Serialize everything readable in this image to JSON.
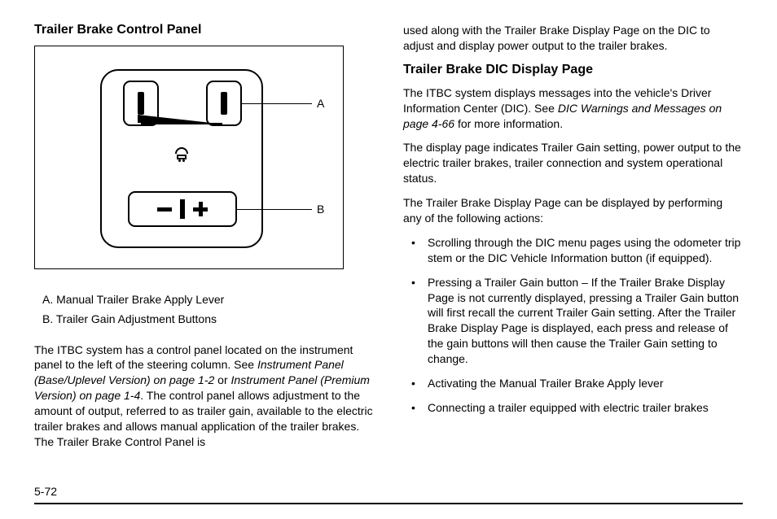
{
  "left": {
    "heading": "Trailer Brake Control Panel",
    "diagram": {
      "labelA": "A",
      "labelB": "B"
    },
    "legendA": "A.  Manual Trailer Brake Apply Lever",
    "legendB": "B.  Trailer Gain Adjustment Buttons",
    "para1_a": "The ITBC system has a control panel located on the instrument panel to the left of the steering column. See ",
    "para1_ital1": "Instrument Panel (Base/Uplevel Version) on page 1-2",
    "para1_b": " or ",
    "para1_ital2": "Instrument Panel (Premium Version) on page 1-4",
    "para1_c": ". The control panel allows adjustment to the amount of output, referred to as trailer gain, available to the electric trailer brakes and allows manual application of the trailer brakes. The Trailer Brake Control Panel is"
  },
  "right": {
    "cont": "used along with the Trailer Brake Display Page on the DIC to adjust and display power output to the trailer brakes.",
    "heading": "Trailer Brake DIC Display Page",
    "p1_a": "The ITBC system displays messages into the vehicle's Driver Information Center (DIC). See ",
    "p1_ital": "DIC Warnings and Messages on page 4-66",
    "p1_b": " for more information.",
    "p2": "The display page indicates Trailer Gain setting, power output to the electric trailer brakes, trailer connection and system operational status.",
    "p3": "The Trailer Brake Display Page can be displayed by performing any of the following actions:",
    "bullets": [
      "Scrolling through the DIC menu pages using the odometer trip stem or the DIC Vehicle Information button (if equipped).",
      "Pressing a Trailer Gain button – If the Trailer Brake Display Page is not currently displayed, pressing a Trailer Gain button will first recall the current Trailer Gain setting. After the Trailer Brake Display Page is displayed, each press and release of the gain buttons will then cause the Trailer Gain setting to change.",
      "Activating the Manual Trailer Brake Apply lever",
      "Connecting a trailer equipped with electric trailer brakes"
    ]
  },
  "pageNumber": "5-72"
}
